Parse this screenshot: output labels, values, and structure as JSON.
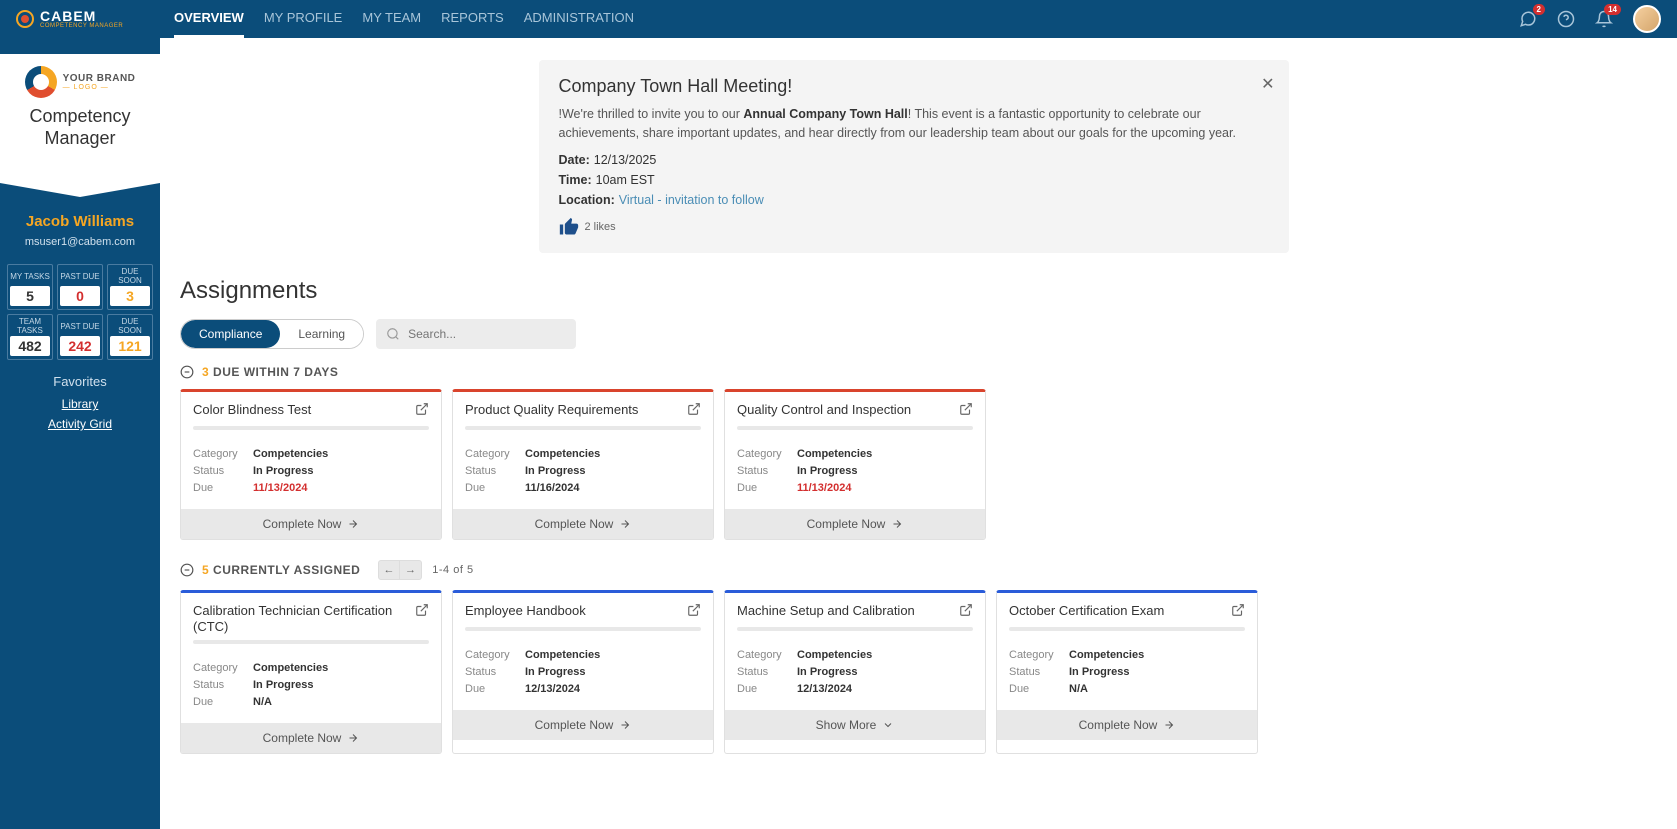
{
  "topnav": {
    "logo": {
      "text": "CABEM",
      "sub": "COMPETENCY MANAGER"
    },
    "items": [
      "OVERVIEW",
      "MY PROFILE",
      "MY TEAM",
      "REPORTS",
      "ADMINISTRATION"
    ],
    "activeIndex": 0,
    "badges": {
      "chat": "2",
      "bell": "14"
    }
  },
  "sidebar": {
    "brand": {
      "line1": "YOUR BRAND",
      "line2": "— LOGO —"
    },
    "appTitle": "Competency Manager",
    "userName": "Jacob Williams",
    "userEmail": "msuser1@cabem.com",
    "stats": [
      {
        "label": "MY TASKS",
        "value": "5",
        "color": ""
      },
      {
        "label": "PAST DUE",
        "value": "0",
        "color": "red"
      },
      {
        "label": "DUE SOON",
        "value": "3",
        "color": "orange"
      },
      {
        "label": "TEAM TASKS",
        "value": "482",
        "color": ""
      },
      {
        "label": "PAST DUE",
        "value": "242",
        "color": "red"
      },
      {
        "label": "DUE SOON",
        "value": "121",
        "color": "orange"
      }
    ],
    "favoritesHeader": "Favorites",
    "favorites": [
      "Library",
      "Activity Grid"
    ]
  },
  "announce": {
    "title": "Company Town Hall Meeting!",
    "leadPrefix": "!We're thrilled to invite you to our ",
    "leadStrong": "Annual Company Town Hall",
    "leadSuffix": "! This event is a fantastic opportunity to celebrate our achievements, share important updates, and hear directly from our leadership team about our goals for the upcoming year.",
    "dateLabel": "Date:",
    "dateValue": "12/13/2025",
    "timeLabel": "Time:",
    "timeValue": "10am EST",
    "locationLabel": "Location:",
    "locationValue": "Virtual - invitation to follow",
    "likes": "2 likes"
  },
  "assignments": {
    "title": "Assignments",
    "tabs": [
      "Compliance",
      "Learning"
    ],
    "activeTab": 0,
    "searchPlaceholder": "Search...",
    "groups": [
      {
        "count": "3",
        "label": "DUE WITHIN 7 DAYS",
        "color": "red",
        "cards": [
          {
            "title": "Color Blindness Test",
            "category": "Competencies",
            "status": "In Progress",
            "due": "11/13/2024",
            "dueColor": "red",
            "action": "Complete Now"
          },
          {
            "title": "Product Quality Requirements",
            "category": "Competencies",
            "status": "In Progress",
            "due": "11/16/2024",
            "dueColor": "",
            "action": "Complete Now"
          },
          {
            "title": "Quality Control and Inspection",
            "category": "Competencies",
            "status": "In Progress",
            "due": "11/13/2024",
            "dueColor": "red",
            "action": "Complete Now"
          }
        ]
      },
      {
        "count": "5",
        "label": "CURRENTLY ASSIGNED",
        "color": "blue",
        "pager": "1-4 of 5",
        "cards": [
          {
            "title": "Calibration Technician Certification (CTC)",
            "category": "Competencies",
            "status": "In Progress",
            "due": "N/A",
            "dueColor": "",
            "action": "Complete Now"
          },
          {
            "title": "Employee Handbook",
            "category": "Competencies",
            "status": "In Progress",
            "due": "12/13/2024",
            "dueColor": "",
            "action": "Complete Now"
          },
          {
            "title": "Machine Setup and Calibration",
            "category": "Competencies",
            "status": "In Progress",
            "due": "12/13/2024",
            "dueColor": "",
            "action": "Show More"
          },
          {
            "title": "October Certification Exam",
            "category": "Competencies",
            "status": "In Progress",
            "due": "N/A",
            "dueColor": "",
            "action": "Complete Now"
          }
        ]
      }
    ],
    "metaLabels": {
      "category": "Category",
      "status": "Status",
      "due": "Due"
    }
  }
}
